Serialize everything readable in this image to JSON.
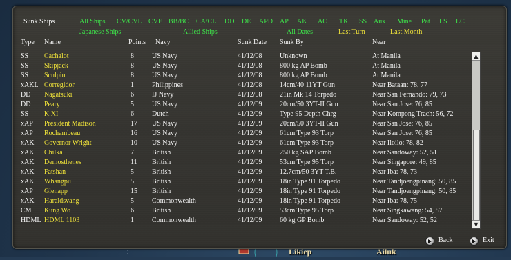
{
  "window": {
    "title": "Sunk Ships"
  },
  "filters_row1": [
    {
      "label": "All Ships",
      "color": "green"
    },
    {
      "label": "CV/CVL",
      "color": "green"
    },
    {
      "label": "CVE",
      "color": "green"
    },
    {
      "label": "BB/BC",
      "color": "green"
    },
    {
      "label": "CA/CL",
      "color": "green"
    },
    {
      "label": "DD",
      "color": "green"
    },
    {
      "label": "DE",
      "color": "green"
    },
    {
      "label": "APD",
      "color": "green"
    },
    {
      "label": "AP",
      "color": "green"
    },
    {
      "label": "AK",
      "color": "green"
    },
    {
      "label": "AO",
      "color": "green"
    },
    {
      "label": "TK",
      "color": "green"
    },
    {
      "label": "SS",
      "color": "green"
    },
    {
      "label": "Aux",
      "color": "green"
    },
    {
      "label": "Mine",
      "color": "green"
    },
    {
      "label": "Pat",
      "color": "green"
    },
    {
      "label": "LS",
      "color": "green"
    },
    {
      "label": "LC",
      "color": "green"
    }
  ],
  "filters_row2": [
    {
      "label": "Japanese Ships",
      "color": "green"
    },
    {
      "label": "Allied Ships",
      "color": "green"
    },
    {
      "label": "All Dates",
      "color": "green"
    },
    {
      "label": "Last Turn",
      "color": "yellow"
    },
    {
      "label": "Last Month",
      "color": "yellow"
    }
  ],
  "columns": {
    "type": "Type",
    "name": "Name",
    "points": "Points",
    "navy": "Navy",
    "sunk_date": "Sunk Date",
    "sunk_by": "Sunk By",
    "near": "Near"
  },
  "rows": [
    {
      "type": "SS",
      "name": "Cachalot",
      "points": "8",
      "navy": "US Navy",
      "date": "41/12/08",
      "by": "Unknown",
      "near": "At Manila"
    },
    {
      "type": "SS",
      "name": "Skipjack",
      "points": "8",
      "navy": "US Navy",
      "date": "41/12/08",
      "by": "800 kg AP Bomb",
      "near": "At Manila"
    },
    {
      "type": "SS",
      "name": "Sculpin",
      "points": "8",
      "navy": "US Navy",
      "date": "41/12/08",
      "by": "800 kg AP Bomb",
      "near": "At Manila"
    },
    {
      "type": "xAKL",
      "name": "Corregidor",
      "points": "1",
      "navy": "Philippines",
      "date": "41/12/08",
      "by": "14cm/40 11YT Gun",
      "near": "Near Bataan: 78, 77"
    },
    {
      "type": "DD",
      "name": "Nagatsuki",
      "points": "6",
      "navy": "IJ Navy",
      "date": "41/12/08",
      "by": "21in Mk 14 Torpedo",
      "near": "Near San Fernando: 79, 73"
    },
    {
      "type": "DD",
      "name": "Peary",
      "points": "5",
      "navy": "US Navy",
      "date": "41/12/09",
      "by": "20cm/50 3YT-II Gun",
      "near": "Near San Jose: 76, 85"
    },
    {
      "type": "SS",
      "name": "K XI",
      "points": "6",
      "navy": "Dutch",
      "date": "41/12/09",
      "by": "Type 95 Depth Chrg",
      "near": "Near Kompong Trach: 56, 72"
    },
    {
      "type": "xAP",
      "name": "President Madison",
      "points": "17",
      "navy": "US Navy",
      "date": "41/12/09",
      "by": "20cm/50 3YT-II Gun",
      "near": "Near San Jose: 76, 85"
    },
    {
      "type": "xAP",
      "name": "Rochambeau",
      "points": "16",
      "navy": "US Navy",
      "date": "41/12/09",
      "by": "61cm Type 93 Torp",
      "near": "Near San Jose: 76, 85"
    },
    {
      "type": "xAK",
      "name": "Governor Wright",
      "points": "10",
      "navy": "US Navy",
      "date": "41/12/09",
      "by": "61cm Type 93 Torp",
      "near": "Near Iloilo: 78, 82"
    },
    {
      "type": "xAK",
      "name": "Chilka",
      "points": "7",
      "navy": "British",
      "date": "41/12/09",
      "by": "250 kg SAP Bomb",
      "near": "Near Sandoway: 52, 51"
    },
    {
      "type": "xAK",
      "name": "Demosthenes",
      "points": "11",
      "navy": "British",
      "date": "41/12/09",
      "by": "53cm Type 95 Torp",
      "near": "Near Singapore: 49, 85"
    },
    {
      "type": "xAK",
      "name": "Fatshan",
      "points": "5",
      "navy": "British",
      "date": "41/12/09",
      "by": "12.7cm/50 3YT T.B.",
      "near": "Near Iba: 78, 73"
    },
    {
      "type": "xAK",
      "name": "Whangpu",
      "points": "5",
      "navy": "British",
      "date": "41/12/09",
      "by": "18in Type 91 Torpedo",
      "near": "Near Tandjoengpinang: 50, 85"
    },
    {
      "type": "xAP",
      "name": "Glenapp",
      "points": "15",
      "navy": "British",
      "date": "41/12/09",
      "by": "18in Type 91 Torpedo",
      "near": "Near Tandjoengpinang: 50, 85"
    },
    {
      "type": "xAK",
      "name": "Haraldsvang",
      "points": "5",
      "navy": "Commonwealth",
      "date": "41/12/09",
      "by": "18in Type 91 Torpedo",
      "near": "Near Iba: 78, 75"
    },
    {
      "type": "CM",
      "name": "Kung Wo",
      "points": "6",
      "navy": "British",
      "date": "41/12/09",
      "by": "53cm Type 95 Torp",
      "near": "Near Singkawang: 54, 87"
    },
    {
      "type": "HDML",
      "name": "HDML 1103",
      "points": "1",
      "navy": "Commonwealth",
      "date": "41/12/09",
      "by": "60 kg GP Bomb",
      "near": "Near Sandoway: 52, 52"
    }
  ],
  "buttons": {
    "back": "Back",
    "exit": "Exit"
  },
  "map_labels": {
    "left": "Likiep",
    "right": "Ailuk"
  },
  "colors": {
    "filter_green": "#3ee24a",
    "name_yellow": "#f0e33a",
    "panel": "#353430",
    "text": "#f2f2f2"
  },
  "icons": {
    "back": "round-arrow-button-icon",
    "exit": "round-arrow-button-icon",
    "scroll_up": "up-arrow-icon",
    "scroll_down": "down-arrow-icon"
  }
}
